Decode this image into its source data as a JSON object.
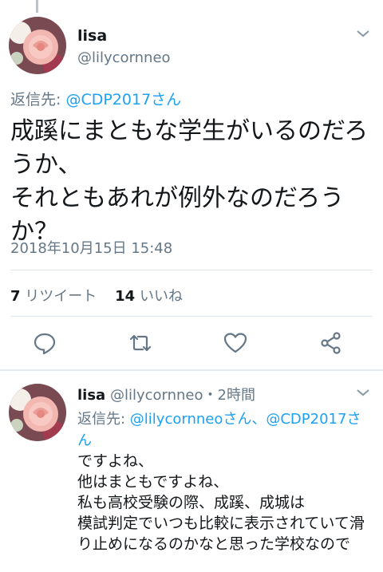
{
  "main_tweet": {
    "display_name": "lisa",
    "handle": "@lilycornneo",
    "replying_prefix": "返信先: ",
    "replying_to": "@CDP2017さん",
    "text": "成蹊にまともな学生がいるのだろうか、\nそれともあれが例外なのだろうか？",
    "timestamp": "2018年10月15日 15:48",
    "retweet_count": "7",
    "retweet_label": "リツイート",
    "like_count": "14",
    "like_label": "いいね",
    "avatar_icon": "rose-avatar-icon"
  },
  "actions": {
    "reply_icon": "reply-icon",
    "retweet_icon": "retweet-icon",
    "like_icon": "heart-icon",
    "share_icon": "share-icon"
  },
  "reply_tweet": {
    "display_name": "lisa",
    "handle": "@lilycornneo",
    "separator": "・",
    "time_ago": "2時間",
    "replying_prefix": "返信先: ",
    "replying_to_1": "@lilycornneoさん",
    "replying_sep": "、",
    "replying_to_2": "@CDP2017さん",
    "text": "ですよね、\n他はまともですよね、\n私も高校受験の際、成蹊、成城は\n模試判定でいつも比較に表示されていて滑り止めになるのかなと思った学校なので"
  },
  "colors": {
    "link": "#1da1f2",
    "secondary_text": "#657786",
    "primary_text": "#14171a"
  }
}
